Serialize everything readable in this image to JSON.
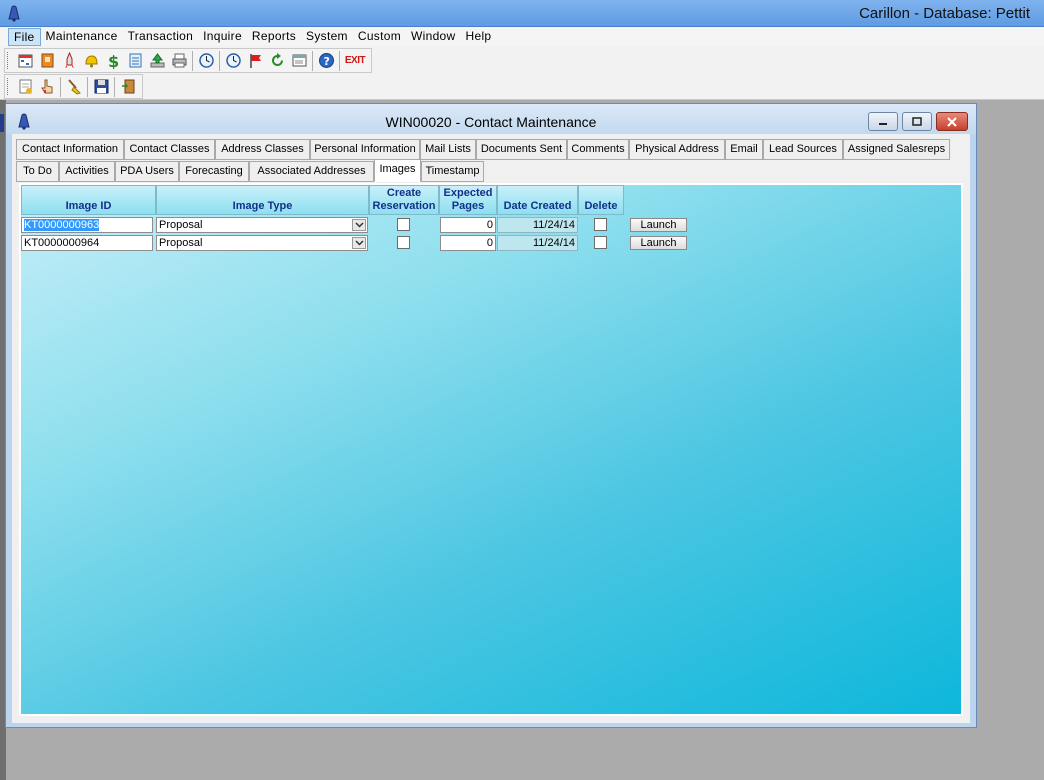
{
  "app": {
    "title": "Carillon - Database: Pettit"
  },
  "menu": [
    "File",
    "Maintenance",
    "Transaction",
    "Inquire",
    "Reports",
    "System",
    "Custom",
    "Window",
    "Help"
  ],
  "toolbar1": {
    "icons": [
      "calendar-icon",
      "address-book-icon",
      "rocket-icon",
      "bell-icon",
      "dollar-icon",
      "notepad-icon",
      "upload-icon",
      "printer-icon",
      "clock-icon",
      "clock-icon",
      "flag-icon",
      "refresh-icon",
      "window-icon",
      "help-icon"
    ],
    "exit_label": "EXIT"
  },
  "toolbar2": {
    "icons": [
      "new-document-icon",
      "hand-pointer-icon",
      "broom-icon",
      "floppy-disk-icon",
      "exit-door-icon"
    ]
  },
  "window": {
    "title": "WIN00020 - Contact Maintenance"
  },
  "tabs_row1": [
    "Contact Information",
    "Contact Classes",
    "Address Classes",
    "Personal Information",
    "Mail Lists",
    "Documents Sent",
    "Comments",
    "Physical Address",
    "Email",
    "Lead Sources",
    "Assigned Salesreps"
  ],
  "tabs_row2": [
    "To Do",
    "Activities",
    "PDA Users",
    "Forecasting",
    "Associated Addresses",
    "Images",
    "Timestamp"
  ],
  "active_tab": "Images",
  "table": {
    "headers": {
      "image_id": "Image ID",
      "image_type": "Image Type",
      "create_res_1": "Create",
      "create_res_2": "Reservation",
      "expected_1": "Expected",
      "expected_2": "Pages",
      "date_created": "Date Created",
      "delete": "Delete"
    },
    "rows": [
      {
        "image_id": "KT0000000963",
        "image_type": "Proposal",
        "create_reservation": false,
        "expected_pages": "0",
        "date_created": "11/24/14",
        "delete": false,
        "launch": "Launch"
      },
      {
        "image_id": "KT0000000964",
        "image_type": "Proposal",
        "create_reservation": false,
        "expected_pages": "0",
        "date_created": "11/24/14",
        "delete": false,
        "launch": "Launch"
      }
    ]
  },
  "colors": {
    "title_bar": "#6ea8ea",
    "panel_start": "#c5eef8",
    "panel_end": "#0db7db",
    "header_text": "#13308a",
    "selection": "#3399ff"
  }
}
